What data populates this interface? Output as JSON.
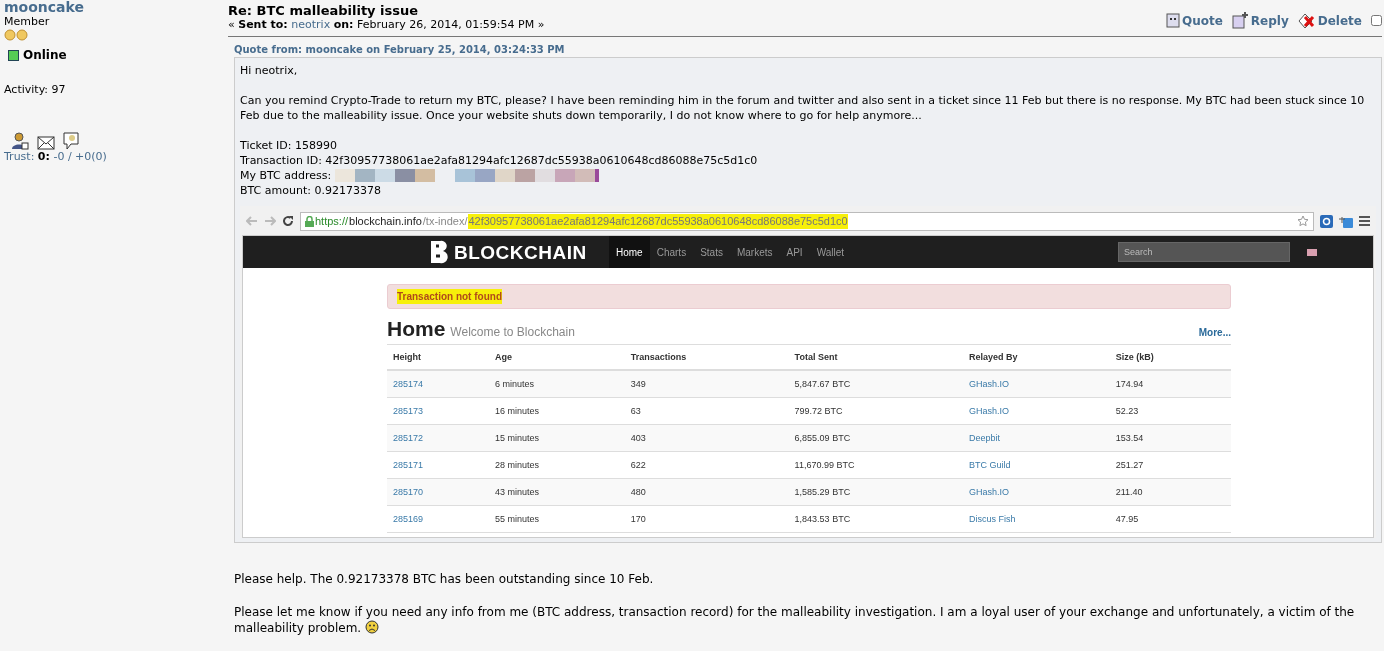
{
  "poster": {
    "name": "mooncake",
    "rank": "Member",
    "status": "Online",
    "online": true,
    "activity": "Activity: 97",
    "trust_label": "Trust:",
    "trust_score": "0:",
    "trust_detail": "-0 / +0(0)"
  },
  "post": {
    "title": "Re: BTC malleability issue",
    "sent_to_label": "Sent to:",
    "recipient": "neotrix",
    "on_label": "on:",
    "date": "February 26, 2014, 01:59:54 PM",
    "open_mark": "«",
    "close_mark": "»",
    "actions": [
      {
        "kind": "quote",
        "label": "Quote"
      },
      {
        "kind": "reply",
        "label": "Reply"
      },
      {
        "kind": "delete",
        "label": "Delete"
      }
    ],
    "select_checked": false
  },
  "quote": {
    "header": "Quote from: mooncake on February 25, 2014, 03:24:33 PM",
    "paragraphs": [
      "Hi neotrix,",
      "Can you remind Crypto-Trade to return my BTC, please? I have been reminding him in the forum and twitter and also sent in a ticket since 11 Feb but there is no response. My BTC had been stuck since 10 Feb due to the malleability issue. Once your website shuts down temporarily, I do not know where to go for help anymore..."
    ],
    "details": [
      "Ticket ID: 158990",
      "Transaction ID: 42f30957738061ae2afa81294afc12687dc55938a0610648cd86088e75c5d1c0"
    ],
    "address_label": "My BTC address:",
    "amount": "BTC amount: 0.92173378",
    "screenshot": {
      "url_scheme": "https://",
      "url_host": "blockchain.info",
      "url_path": "/tx-index/",
      "url_hash": "42f30957738061ae2afa81294afc12687dc55938a0610648cd86088e75c5d1c0",
      "hash_highlighted": true,
      "brand": "BLOCKCHAIN",
      "nav": [
        {
          "label": "Home",
          "selected": true
        },
        {
          "label": "Charts",
          "selected": false
        },
        {
          "label": "Stats",
          "selected": false
        },
        {
          "label": "Markets",
          "selected": false
        },
        {
          "label": "API",
          "selected": false
        },
        {
          "label": "Wallet",
          "selected": false
        }
      ],
      "search_placeholder": "Search",
      "alert": "Transaction not found",
      "alert_highlighted": true,
      "heading": "Home",
      "subheading": "Welcome to Blockchain",
      "more": "More...",
      "columns": [
        "Height",
        "Age",
        "Transactions",
        "Total Sent",
        "Relayed By",
        "Size (kB)"
      ],
      "rows": [
        [
          "285174",
          "6 minutes",
          "349",
          "5,847.67 BTC",
          "GHash.IO",
          "174.94"
        ],
        [
          "285173",
          "16 minutes",
          "63",
          "799.72 BTC",
          "GHash.IO",
          "52.23"
        ],
        [
          "285172",
          "15 minutes",
          "403",
          "6,855.09 BTC",
          "Deepbit",
          "153.54"
        ],
        [
          "285171",
          "28 minutes",
          "622",
          "11,670.99 BTC",
          "BTC Guild",
          "251.27"
        ],
        [
          "285170",
          "43 minutes",
          "480",
          "1,585.29 BTC",
          "GHash.IO",
          "211.40"
        ],
        [
          "285169",
          "55 minutes",
          "170",
          "1,843.53 BTC",
          "Discus Fish",
          "47.95"
        ]
      ]
    }
  },
  "body": [
    "Please help. The 0.92173378 BTC has been outstanding since 10 Feb.",
    "Please let me know if you need any info from me (BTC address, transaction record) for the malleability investigation. I am a loyal user of your exchange and unfortunately, a victim of the malleability problem."
  ]
}
